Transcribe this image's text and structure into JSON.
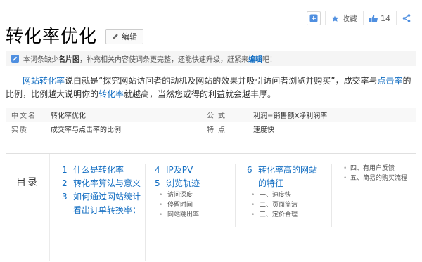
{
  "toolbar": {
    "add_icon": "plus-square-icon",
    "star_label": "收藏",
    "like_count": "14",
    "share_icon": "share-icon"
  },
  "page": {
    "title": "转化率优化",
    "edit_label": "编辑"
  },
  "notice": {
    "text_before": "本词条缺少",
    "bold": "名片图",
    "text_after": "，补充相关内容使词条更完整，还能快速升级，赶紧来",
    "link": "编辑",
    "tail": "吧！"
  },
  "summary": {
    "l1": "网站转化率",
    "t1": "说白就是“探究网站访问者的动机及网站的效果并吸引访问者浏览并购买”，成交率与",
    "l2": "点击率",
    "t2": "的比例，比例越大说明你的",
    "l3": "转化率",
    "t3": "就越高，当然您或得的利益就会越丰厚。"
  },
  "basic_info": [
    {
      "k1": "中文名",
      "v1": "转化率优化",
      "k2": "公式",
      "v2": "利润=销售额X净利润率"
    },
    {
      "k1": "实质",
      "v1": "成交率与点击率的比例",
      "k2": "特点",
      "v2": "速度快"
    }
  ],
  "toc": {
    "label": "目录",
    "col1": [
      {
        "num": "1",
        "text": "什么是转化率"
      },
      {
        "num": "2",
        "text": "转化率算法与意义"
      },
      {
        "num": "3",
        "text": "如何通过网站统计看出订单转换率："
      }
    ],
    "col2": [
      {
        "num": "4",
        "text": "IP及PV"
      },
      {
        "num": "5",
        "text": "浏览轨迹"
      }
    ],
    "col2_subs": [
      "访问深度",
      "停留时间",
      "网站跳出率"
    ],
    "col3": [
      {
        "num": "6",
        "text": "转化率高的网站的特征"
      }
    ],
    "col3_subs": [
      "一、速度快",
      "二、页面简洁",
      "三、定价合理"
    ],
    "col4_subs": [
      "四、有用户反馈",
      "五、简易的购买流程"
    ]
  },
  "colors": {
    "link": "#136ec2",
    "accent_icon": "#4f8fe0"
  }
}
